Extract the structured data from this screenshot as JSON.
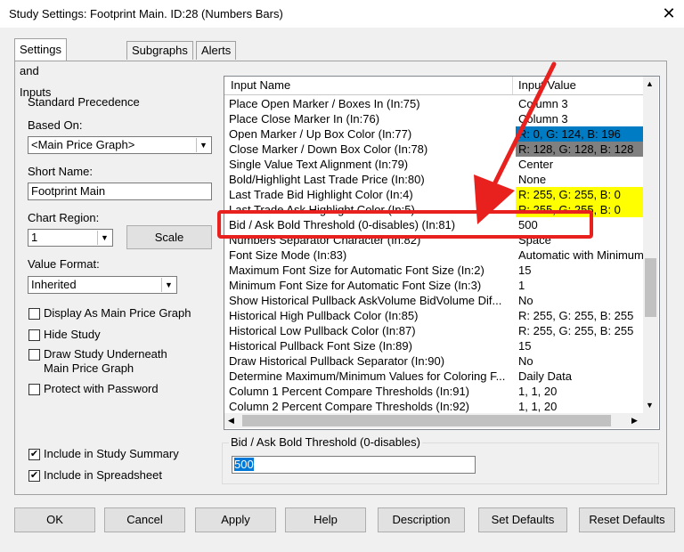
{
  "window": {
    "title": "Study Settings: Footprint Main. ID:28 (Numbers Bars)",
    "close_glyph": "✕"
  },
  "tabs": [
    {
      "label": "Settings and Inputs",
      "active": true
    },
    {
      "label": "Subgraphs",
      "active": false
    },
    {
      "label": "Alerts",
      "active": false
    }
  ],
  "left": {
    "standard_precedence": "Standard Precedence",
    "based_on_label": "Based On:",
    "based_on_value": "<Main Price Graph>",
    "short_name_label": "Short Name:",
    "short_name_value": "Footprint Main",
    "chart_region_label": "Chart Region:",
    "chart_region_value": "1",
    "scale_button": "Scale",
    "value_format_label": "Value Format:",
    "value_format_value": "Inherited",
    "cb_display_main": "Display As Main Price Graph",
    "cb_hide_study": "Hide Study",
    "cb_draw_under_1": "Draw Study Underneath",
    "cb_draw_under_2": "Main Price Graph",
    "cb_protect": "Protect with Password",
    "cb_include_summary": "Include in Study Summary",
    "cb_include_spreadsheet": "Include in Spreadsheet",
    "check_mark": "✔"
  },
  "grid": {
    "col_name": "Input Name",
    "col_value": "Input Value",
    "rows": [
      {
        "name": "Place Open Marker / Boxes In   (In:75)",
        "value": "Column 3",
        "bg": "",
        "fg": ""
      },
      {
        "name": "Place Close Marker In   (In:76)",
        "value": "Column 3",
        "bg": "",
        "fg": ""
      },
      {
        "name": "Open Marker / Up Box Color   (In:77)",
        "value": "R: 0, G: 124, B: 196",
        "bg": "#007cc4",
        "fg": "#000000"
      },
      {
        "name": "Close Marker / Down Box Color   (In:78)",
        "value": "R: 128, G: 128, B: 128",
        "bg": "#808080",
        "fg": "#000000"
      },
      {
        "name": "Single Value Text Alignment   (In:79)",
        "value": "Center",
        "bg": "",
        "fg": ""
      },
      {
        "name": "Bold/Highlight Last Trade Price   (In:80)",
        "value": "None",
        "bg": "",
        "fg": ""
      },
      {
        "name": "Last Trade Bid Highlight Color   (In:4)",
        "value": "R: 255, G: 255, B: 0",
        "bg": "#ffff00",
        "fg": "#000000"
      },
      {
        "name": "Last Trade Ask Highlight Color   (In:5)",
        "value": "R: 255, G: 255, B: 0",
        "bg": "#ffff00",
        "fg": "#000000"
      },
      {
        "name": "Bid / Ask Bold Threshold (0-disables)   (In:81)",
        "value": "500",
        "bg": "",
        "fg": ""
      },
      {
        "name": "Numbers Separator Character   (In:82)",
        "value": "Space",
        "bg": "",
        "fg": ""
      },
      {
        "name": "Font Size Mode   (In:83)",
        "value": "Automatic with Minimum",
        "bg": "",
        "fg": ""
      },
      {
        "name": "Maximum Font Size for Automatic Font Size   (In:2)",
        "value": "15",
        "bg": "",
        "fg": ""
      },
      {
        "name": "Minimum Font Size for Automatic Font Size   (In:3)",
        "value": "1",
        "bg": "",
        "fg": ""
      },
      {
        "name": "Show Historical Pullback AskVolume BidVolume Dif...",
        "value": "No",
        "bg": "",
        "fg": ""
      },
      {
        "name": "Historical High Pullback Color   (In:85)",
        "value": "R: 255, G: 255, B: 255",
        "bg": "",
        "fg": ""
      },
      {
        "name": "Historical Low Pullback Color   (In:87)",
        "value": "R: 255, G: 255, B: 255",
        "bg": "",
        "fg": ""
      },
      {
        "name": "Historical Pullback Font Size   (In:89)",
        "value": "15",
        "bg": "",
        "fg": ""
      },
      {
        "name": "Draw Historical Pullback Separator   (In:90)",
        "value": "No",
        "bg": "",
        "fg": ""
      },
      {
        "name": "Determine Maximum/Minimum Values for Coloring F...",
        "value": "Daily Data",
        "bg": "",
        "fg": ""
      },
      {
        "name": "Column 1 Percent Compare Thresholds   (In:91)",
        "value": "1, 1, 20",
        "bg": "",
        "fg": ""
      },
      {
        "name": "Column 2 Percent Compare Thresholds   (In:92)",
        "value": "1, 1, 20",
        "bg": "",
        "fg": ""
      }
    ],
    "scroll_up": "▲",
    "scroll_down": "▼",
    "scroll_left": "◀",
    "scroll_right": "▶"
  },
  "editor": {
    "label": "Bid / Ask Bold Threshold (0-disables)",
    "value": "500"
  },
  "buttons": {
    "ok": "OK",
    "cancel": "Cancel",
    "apply": "Apply",
    "help": "Help",
    "description": "Description",
    "set_defaults": "Set Defaults",
    "reset_defaults": "Reset Defaults"
  },
  "combo_arrow": "▼",
  "accent": {
    "highlight": "#e8201e",
    "selection": "#0078d7"
  }
}
